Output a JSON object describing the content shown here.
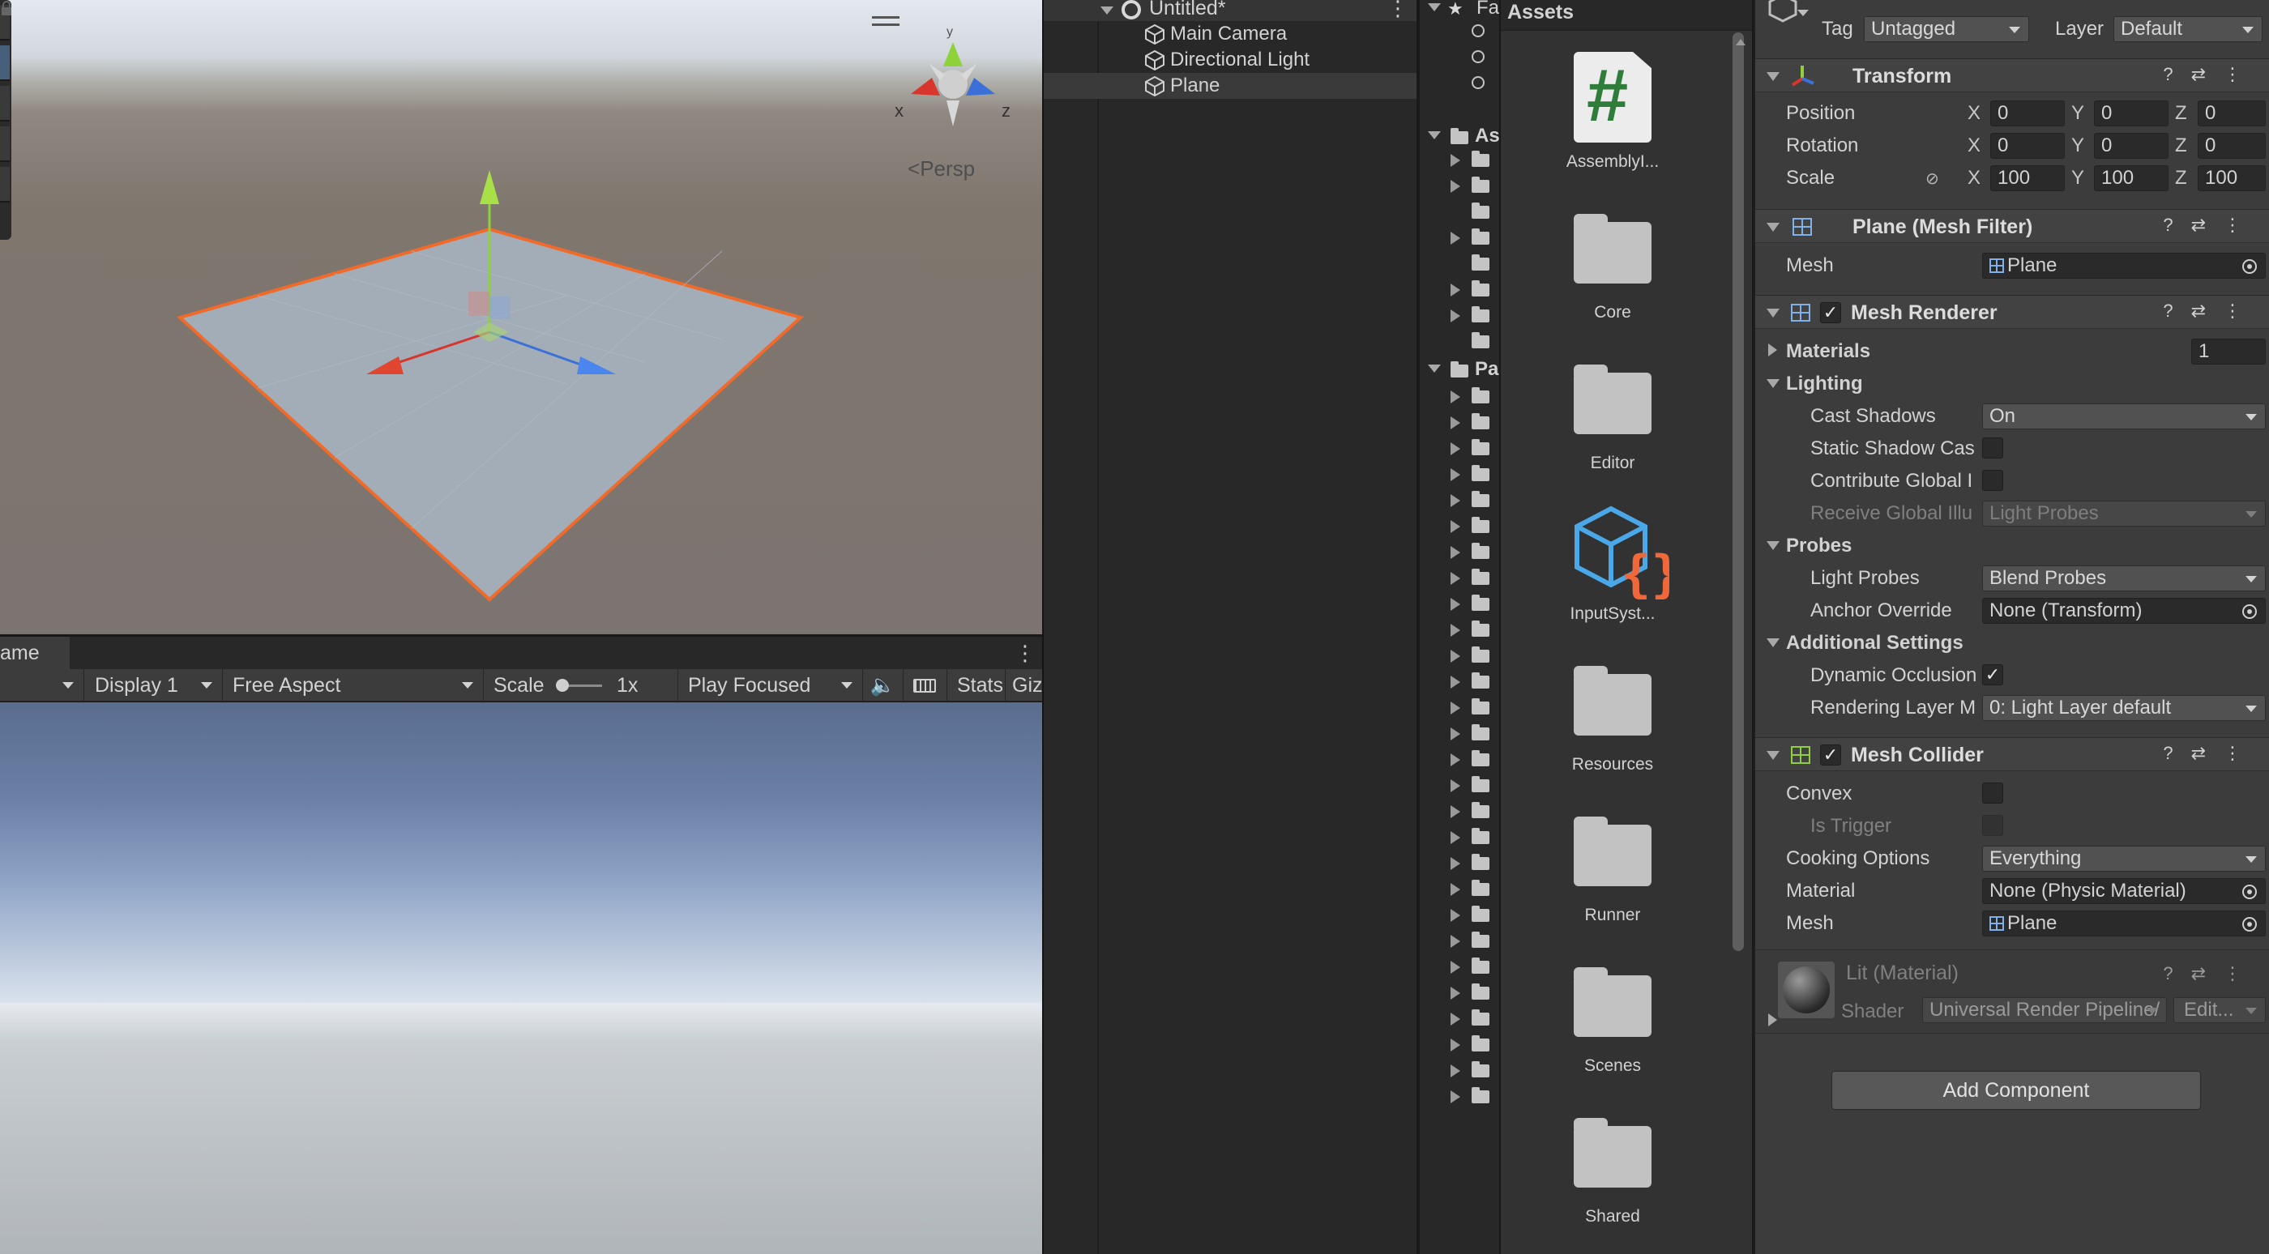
{
  "scene": {
    "projection_label": "Persp",
    "gizmo_axes": [
      "x",
      "y",
      "z"
    ]
  },
  "game": {
    "tab_label": "ame",
    "display": "Display 1",
    "aspect": "Free Aspect",
    "scale_label": "Scale",
    "scale_value": "1x",
    "play_mode": "Play Focused",
    "stats_label": "Stats",
    "gizmos_label": "Giz"
  },
  "hierarchy": {
    "scene_name": "Untitled*",
    "items": [
      "Main Camera",
      "Directional Light",
      "Plane"
    ],
    "selected": "Plane"
  },
  "project": {
    "favorites_label": "Fa",
    "assets_root": "As",
    "packages_root": "Pa",
    "grid_title": "Assets",
    "items": [
      "AssemblyI...",
      "Core",
      "Editor",
      "InputSyst...",
      "Resources",
      "Runner",
      "Scenes",
      "Shared"
    ]
  },
  "inspector": {
    "tag_label": "Tag",
    "tag_value": "Untagged",
    "layer_label": "Layer",
    "layer_value": "Default",
    "transform": {
      "title": "Transform",
      "position_label": "Position",
      "rotation_label": "Rotation",
      "scale_label": "Scale",
      "position": [
        "0",
        "0",
        "0"
      ],
      "rotation": [
        "0",
        "0",
        "0"
      ],
      "scale": [
        "100",
        "100",
        "100"
      ]
    },
    "mesh_filter": {
      "title": "Plane (Mesh Filter)",
      "mesh_label": "Mesh",
      "mesh_value": "Plane"
    },
    "mesh_renderer": {
      "title": "Mesh Renderer",
      "materials_label": "Materials",
      "materials_count": "1",
      "lighting_label": "Lighting",
      "cast_shadows_label": "Cast Shadows",
      "cast_shadows_value": "On",
      "static_shadow_label": "Static Shadow Cas",
      "contribute_gi_label": "Contribute Global I",
      "receive_gi_label": "Receive Global Illu",
      "receive_gi_value": "Light Probes",
      "probes_label": "Probes",
      "light_probes_label": "Light Probes",
      "light_probes_value": "Blend Probes",
      "anchor_label": "Anchor Override",
      "anchor_value": "None (Transform)",
      "additional_label": "Additional Settings",
      "dynamic_occ_label": "Dynamic Occlusion",
      "rendering_layer_label": "Rendering Layer M",
      "rendering_layer_value": "0: Light Layer default"
    },
    "mesh_collider": {
      "title": "Mesh Collider",
      "convex_label": "Convex",
      "is_trigger_label": "Is Trigger",
      "cooking_label": "Cooking Options",
      "cooking_value": "Everything",
      "material_label": "Material",
      "material_value": "None (Physic Material)",
      "mesh_label": "Mesh",
      "mesh_value": "Plane"
    },
    "material": {
      "title": "Lit (Material)",
      "shader_label": "Shader",
      "shader_value": "Universal Render Pipeline/",
      "edit_label": "Edit..."
    },
    "add_component": "Add Component"
  },
  "colors": {
    "selection_outline": "#f06a2a",
    "axis_x": "#d8362c",
    "axis_y": "#8fd13a",
    "axis_z": "#3a70d8"
  }
}
